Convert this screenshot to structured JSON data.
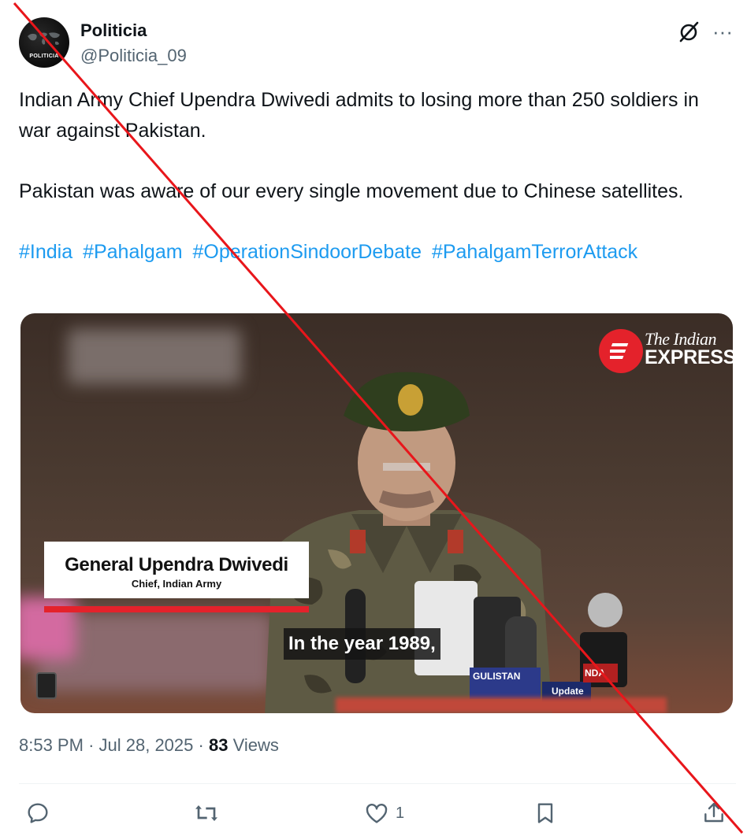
{
  "author": {
    "display_name": "Politicia",
    "handle": "@Politicia_09",
    "avatar_text": "POLITICIA"
  },
  "tweet": {
    "paragraphs": [
      "Indian Army Chief Upendra Dwivedi admits to losing more than 250 soldiers in war against Pakistan.",
      "Pakistan was aware of our every single movement due to Chinese satellites."
    ],
    "hashtags": [
      "#India",
      "#Pahalgam",
      "#OperationSindoorDebate",
      "#PahalgamTerrorAttack"
    ]
  },
  "media": {
    "logo_line1": "The Indian",
    "logo_line2": "EXPRESS",
    "lower_third_name": "General Upendra Dwivedi",
    "lower_third_title": "Chief, Indian Army",
    "subtitle": "In the year 1989,",
    "mic_labels": [
      "GULISTAN",
      "Update",
      "NDA"
    ]
  },
  "meta": {
    "time": "8:53 PM",
    "separator": "·",
    "date": "Jul 28, 2025",
    "views_count": "83",
    "views_label": "Views"
  },
  "actions": {
    "reply_count": "",
    "retweet_count": "",
    "like_count": "1"
  },
  "colors": {
    "link": "#1d9bf0",
    "muted": "#536471",
    "text": "#0f1419",
    "overlay_line": "#e8161b",
    "brand_red": "#e4222b"
  },
  "icons": [
    "grok-icon",
    "more-icon",
    "reply-icon",
    "retweet-icon",
    "like-icon",
    "bookmark-icon",
    "share-icon"
  ]
}
